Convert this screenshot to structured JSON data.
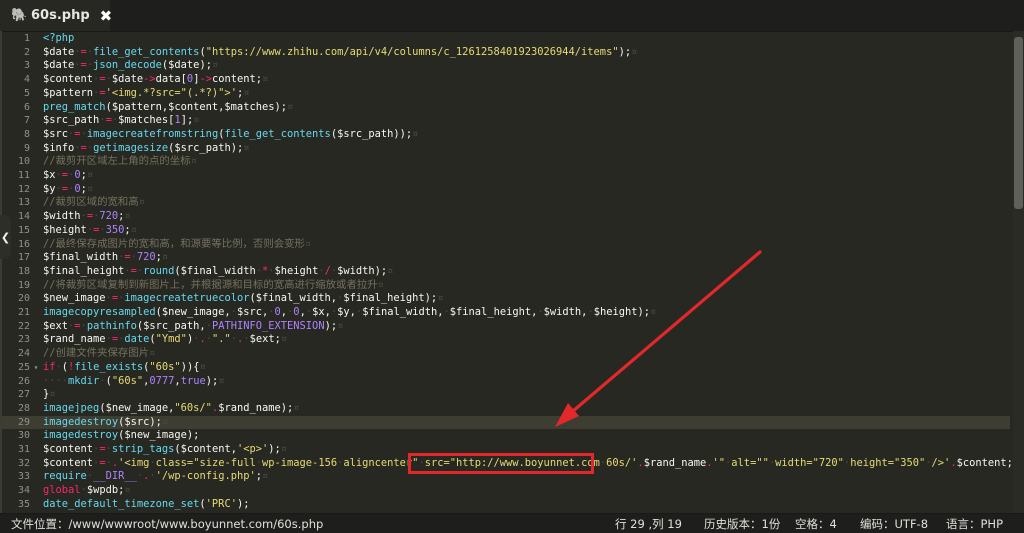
{
  "tab": {
    "filename": "60s.php",
    "close": "✖",
    "icon": "elephant-icon"
  },
  "editor": {
    "active_line": 29,
    "lines": [
      {
        "n": "1",
        "tokens": [
          [
            "k",
            "<?php"
          ]
        ]
      },
      {
        "n": "2",
        "tokens": [
          [
            "v",
            "$date"
          ],
          [
            "d",
            "·"
          ],
          [
            "o",
            "="
          ],
          [
            "d",
            "·"
          ],
          [
            "k",
            "file_get_contents"
          ],
          [
            "v",
            "("
          ],
          [
            "s",
            "\"https://www.zhihu.com/api/v4/columns/c_1261258401923026944/items\""
          ],
          [
            "v",
            ");"
          ],
          [
            "d",
            "¤"
          ]
        ]
      },
      {
        "n": "3",
        "tokens": [
          [
            "v",
            "$date"
          ],
          [
            "d",
            "·"
          ],
          [
            "o",
            "="
          ],
          [
            "d",
            "·"
          ],
          [
            "k",
            "json_decode"
          ],
          [
            "v",
            "($date);"
          ],
          [
            "d",
            "¤"
          ]
        ]
      },
      {
        "n": "4",
        "tokens": [
          [
            "v",
            "$content"
          ],
          [
            "d",
            "·"
          ],
          [
            "o",
            "="
          ],
          [
            "d",
            "·"
          ],
          [
            "v",
            "$date"
          ],
          [
            "o",
            "->"
          ],
          [
            "v",
            "data["
          ],
          [
            "n",
            "0"
          ],
          [
            "v",
            "]"
          ],
          [
            "o",
            "->"
          ],
          [
            "v",
            "content;"
          ],
          [
            "d",
            "¤"
          ]
        ]
      },
      {
        "n": "5",
        "tokens": [
          [
            "v",
            "$pattern"
          ],
          [
            "d",
            "·"
          ],
          [
            "o",
            "="
          ],
          [
            "s",
            "'<img.*?src=\"(.*?)\">'"
          ],
          [
            "v",
            ";"
          ],
          [
            "d",
            "¤"
          ]
        ]
      },
      {
        "n": "6",
        "tokens": [
          [
            "k",
            "preg_match"
          ],
          [
            "v",
            "($pattern,$content,$matches);"
          ],
          [
            "d",
            "¤"
          ]
        ]
      },
      {
        "n": "7",
        "tokens": [
          [
            "v",
            "$src_path"
          ],
          [
            "d",
            "·"
          ],
          [
            "o",
            "="
          ],
          [
            "d",
            "·"
          ],
          [
            "v",
            "$matches["
          ],
          [
            "n",
            "1"
          ],
          [
            "v",
            "];"
          ],
          [
            "d",
            "¤"
          ]
        ]
      },
      {
        "n": "8",
        "tokens": [
          [
            "v",
            "$src"
          ],
          [
            "d",
            "·"
          ],
          [
            "o",
            "="
          ],
          [
            "d",
            "·"
          ],
          [
            "k",
            "imagecreatefromstring"
          ],
          [
            "v",
            "("
          ],
          [
            "k",
            "file_get_contents"
          ],
          [
            "v",
            "($src_path));"
          ],
          [
            "d",
            "¤"
          ]
        ]
      },
      {
        "n": "9",
        "tokens": [
          [
            "v",
            "$info"
          ],
          [
            "d",
            "·"
          ],
          [
            "o",
            "="
          ],
          [
            "d",
            "·"
          ],
          [
            "k",
            "getimagesize"
          ],
          [
            "v",
            "($src_path);"
          ],
          [
            "d",
            "¤"
          ]
        ]
      },
      {
        "n": "10",
        "tokens": [
          [
            "c",
            "//裁剪开区域左上角的点的坐标"
          ],
          [
            "d",
            "¤"
          ]
        ]
      },
      {
        "n": "11",
        "tokens": [
          [
            "v",
            "$x"
          ],
          [
            "d",
            "·"
          ],
          [
            "o",
            "="
          ],
          [
            "d",
            "·"
          ],
          [
            "n",
            "0"
          ],
          [
            "v",
            ";"
          ],
          [
            "d",
            "¤"
          ]
        ]
      },
      {
        "n": "12",
        "tokens": [
          [
            "v",
            "$y"
          ],
          [
            "d",
            "·"
          ],
          [
            "o",
            "="
          ],
          [
            "d",
            "·"
          ],
          [
            "n",
            "0"
          ],
          [
            "v",
            ";"
          ],
          [
            "d",
            "¤"
          ]
        ]
      },
      {
        "n": "13",
        "tokens": [
          [
            "c",
            "//裁剪区域的宽和高"
          ],
          [
            "d",
            "¤"
          ]
        ]
      },
      {
        "n": "14",
        "tokens": [
          [
            "v",
            "$width"
          ],
          [
            "d",
            "·"
          ],
          [
            "o",
            "="
          ],
          [
            "d",
            "·"
          ],
          [
            "n",
            "720"
          ],
          [
            "v",
            ";"
          ],
          [
            "d",
            "¤"
          ]
        ]
      },
      {
        "n": "15",
        "tokens": [
          [
            "v",
            "$height"
          ],
          [
            "d",
            "·"
          ],
          [
            "o",
            "="
          ],
          [
            "d",
            "·"
          ],
          [
            "n",
            "350"
          ],
          [
            "v",
            ";"
          ],
          [
            "d",
            "¤"
          ]
        ]
      },
      {
        "n": "16",
        "tokens": [
          [
            "c",
            "//最终保存成图片的宽和高，和源要等比例，否则会变形"
          ],
          [
            "d",
            "¤"
          ]
        ]
      },
      {
        "n": "17",
        "tokens": [
          [
            "v",
            "$final_width"
          ],
          [
            "d",
            "·"
          ],
          [
            "o",
            "="
          ],
          [
            "d",
            "·"
          ],
          [
            "n",
            "720"
          ],
          [
            "v",
            ";"
          ],
          [
            "d",
            "¤"
          ]
        ]
      },
      {
        "n": "18",
        "tokens": [
          [
            "v",
            "$final_height"
          ],
          [
            "d",
            "·"
          ],
          [
            "o",
            "="
          ],
          [
            "d",
            "·"
          ],
          [
            "k",
            "round"
          ],
          [
            "v",
            "($final_width"
          ],
          [
            "d",
            "·"
          ],
          [
            "o",
            "*"
          ],
          [
            "d",
            "·"
          ],
          [
            "v",
            "$height"
          ],
          [
            "d",
            "·"
          ],
          [
            "o",
            "/"
          ],
          [
            "d",
            "·"
          ],
          [
            "v",
            "$width);"
          ],
          [
            "d",
            "¤"
          ]
        ]
      },
      {
        "n": "19",
        "tokens": [
          [
            "c",
            "//将裁剪区域复制到新图片上，并根据源和目标的宽高进行缩放或者拉升"
          ],
          [
            "d",
            "¤"
          ]
        ]
      },
      {
        "n": "20",
        "tokens": [
          [
            "v",
            "$new_image"
          ],
          [
            "d",
            "·"
          ],
          [
            "o",
            "="
          ],
          [
            "d",
            "·"
          ],
          [
            "k",
            "imagecreatetruecolor"
          ],
          [
            "v",
            "($final_width,"
          ],
          [
            "d",
            "·"
          ],
          [
            "v",
            "$final_height);"
          ],
          [
            "d",
            "¤"
          ]
        ]
      },
      {
        "n": "21",
        "tokens": [
          [
            "k",
            "imagecopyresampled"
          ],
          [
            "v",
            "($new_image,"
          ],
          [
            "d",
            "·"
          ],
          [
            "v",
            "$src,"
          ],
          [
            "d",
            "·"
          ],
          [
            "n",
            "0"
          ],
          [
            "v",
            ","
          ],
          [
            "d",
            "·"
          ],
          [
            "n",
            "0"
          ],
          [
            "v",
            ","
          ],
          [
            "d",
            "·"
          ],
          [
            "v",
            "$x,"
          ],
          [
            "d",
            "·"
          ],
          [
            "v",
            "$y,"
          ],
          [
            "d",
            "·"
          ],
          [
            "v",
            "$final_width,"
          ],
          [
            "d",
            "·"
          ],
          [
            "v",
            "$final_height,"
          ],
          [
            "d",
            "·"
          ],
          [
            "v",
            "$width,"
          ],
          [
            "d",
            "·"
          ],
          [
            "v",
            "$height);"
          ],
          [
            "d",
            "¤"
          ]
        ]
      },
      {
        "n": "22",
        "tokens": [
          [
            "v",
            "$ext"
          ],
          [
            "d",
            "·"
          ],
          [
            "o",
            "="
          ],
          [
            "d",
            "·"
          ],
          [
            "k",
            "pathinfo"
          ],
          [
            "v",
            "($src_path,"
          ],
          [
            "d",
            "·"
          ],
          [
            "n",
            "PATHINFO_EXTENSION"
          ],
          [
            "v",
            ");"
          ],
          [
            "d",
            "¤"
          ]
        ]
      },
      {
        "n": "23",
        "tokens": [
          [
            "v",
            "$rand_name"
          ],
          [
            "d",
            "·"
          ],
          [
            "o",
            "="
          ],
          [
            "d",
            "·"
          ],
          [
            "k",
            "date"
          ],
          [
            "v",
            "("
          ],
          [
            "s",
            "\"Ymd\""
          ],
          [
            "v",
            ")"
          ],
          [
            "d",
            "·"
          ],
          [
            "o",
            "."
          ],
          [
            "d",
            "·"
          ],
          [
            "s",
            "\".\""
          ],
          [
            "d",
            "·"
          ],
          [
            "o",
            "."
          ],
          [
            "d",
            "·"
          ],
          [
            "v",
            "$ext;"
          ],
          [
            "d",
            "¤"
          ]
        ]
      },
      {
        "n": "24",
        "tokens": [
          [
            "c",
            "//创建文件夹保存图片"
          ],
          [
            "d",
            "¤"
          ]
        ]
      },
      {
        "n": "25",
        "fold": "▾",
        "tokens": [
          [
            "o",
            "if"
          ],
          [
            "d",
            "·"
          ],
          [
            "v",
            "("
          ],
          [
            "o",
            "!"
          ],
          [
            "k",
            "file_exists"
          ],
          [
            "v",
            "("
          ],
          [
            "s",
            "\"60s\""
          ],
          [
            "v",
            "))"
          ],
          [
            "v",
            "{"
          ],
          [
            "d",
            "¤"
          ]
        ]
      },
      {
        "n": "26",
        "tokens": [
          [
            "d",
            "····"
          ],
          [
            "k",
            "mkdir"
          ],
          [
            "d",
            "·"
          ],
          [
            "v",
            "("
          ],
          [
            "s",
            "\"60s\""
          ],
          [
            "v",
            ","
          ],
          [
            "n",
            "0777"
          ],
          [
            "v",
            ","
          ],
          [
            "n",
            "true"
          ],
          [
            "v",
            ");"
          ],
          [
            "d",
            "¤"
          ]
        ]
      },
      {
        "n": "27",
        "tokens": [
          [
            "v",
            "}"
          ],
          [
            "d",
            "¤"
          ]
        ]
      },
      {
        "n": "28",
        "tokens": [
          [
            "k",
            "imagejpeg"
          ],
          [
            "v",
            "($new_image,"
          ],
          [
            "s",
            "\"60s/\""
          ],
          [
            "o",
            "."
          ],
          [
            "v",
            "$rand_name);"
          ],
          [
            "d",
            "¤"
          ]
        ]
      },
      {
        "n": "29",
        "tokens": [
          [
            "k",
            "imagedestroy"
          ],
          [
            "v",
            "($src);"
          ],
          [
            "d",
            "¤"
          ]
        ]
      },
      {
        "n": "30",
        "tokens": [
          [
            "k",
            "imagedestroy"
          ],
          [
            "v",
            "($new_image);"
          ]
        ]
      },
      {
        "n": "31",
        "tokens": [
          [
            "v",
            "$content"
          ],
          [
            "d",
            "·"
          ],
          [
            "o",
            "="
          ],
          [
            "d",
            "·"
          ],
          [
            "k",
            "strip_tags"
          ],
          [
            "v",
            "($content,"
          ],
          [
            "s",
            "'<p>'"
          ],
          [
            "v",
            ");"
          ],
          [
            "d",
            "¤"
          ]
        ]
      },
      {
        "n": "32",
        "tokens": [
          [
            "v",
            "$content"
          ],
          [
            "d",
            "·"
          ],
          [
            "o",
            "="
          ],
          [
            "d",
            "·"
          ],
          [
            "o",
            "."
          ],
          [
            "s",
            "'<img"
          ],
          [
            "d",
            "·"
          ],
          [
            "s",
            "class=\"size-full"
          ],
          [
            "d",
            "·"
          ],
          [
            "s",
            "wp-image-156"
          ],
          [
            "d",
            "·"
          ],
          [
            "s",
            "aligncenter\""
          ],
          [
            "d",
            "·"
          ],
          [
            "s",
            "src=\"http://www.boyunnet.com"
          ],
          [
            "d",
            "·"
          ],
          [
            "s",
            "60s/'"
          ],
          [
            "o",
            "."
          ],
          [
            "v",
            "$rand_name"
          ],
          [
            "o",
            "."
          ],
          [
            "s",
            "'\""
          ],
          [
            "d",
            "·"
          ],
          [
            "s",
            "alt=\"\""
          ],
          [
            "d",
            "·"
          ],
          [
            "s",
            "width=\"720\""
          ],
          [
            "d",
            "·"
          ],
          [
            "s",
            "height=\"350\""
          ],
          [
            "d",
            "·"
          ],
          [
            "s",
            "/>'"
          ],
          [
            "o",
            "."
          ],
          [
            "v",
            "$content;"
          ],
          [
            "d",
            "¤"
          ]
        ]
      },
      {
        "n": "33",
        "tokens": [
          [
            "k",
            "require"
          ],
          [
            "d",
            "·"
          ],
          [
            "n",
            "__DIR__"
          ],
          [
            "d",
            "·"
          ],
          [
            "o",
            "."
          ],
          [
            "d",
            "·"
          ],
          [
            "s",
            "'/wp-config.php'"
          ],
          [
            "v",
            ";"
          ],
          [
            "d",
            "¤"
          ]
        ]
      },
      {
        "n": "34",
        "tokens": [
          [
            "o",
            "global"
          ],
          [
            "d",
            "·"
          ],
          [
            "v",
            "$wpdb;"
          ],
          [
            "d",
            "¤"
          ]
        ]
      },
      {
        "n": "35",
        "tokens": [
          [
            "k",
            "date_default_timezone_set"
          ],
          [
            "v",
            "("
          ],
          [
            "s",
            "'PRC'"
          ],
          [
            "v",
            ");"
          ]
        ]
      }
    ]
  },
  "status": {
    "path": "文件位置：/www/wwwroot/www.boyunnet.com/60s.php",
    "position": "行 29 ,列 19",
    "history": "历史版本：1份",
    "indent": "空格：4",
    "encoding": "编码：UTF-8",
    "language": "语言：PHP"
  },
  "annotation": {
    "color": "#e3282b"
  }
}
